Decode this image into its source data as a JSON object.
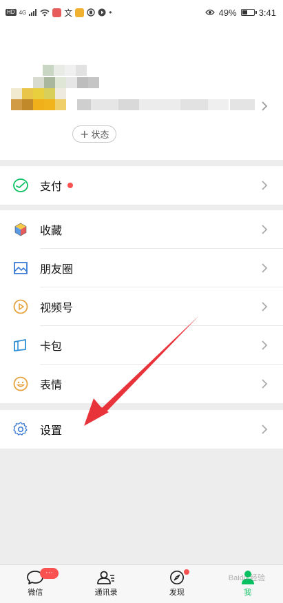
{
  "status_bar": {
    "hd": "HD",
    "network": "4G",
    "battery_percent": "49%",
    "battery_level": 0.49,
    "time": "3:41",
    "wen_icon_text": "文"
  },
  "profile": {
    "status_button_label": "状态",
    "status_button_plus": "+"
  },
  "groups": [
    {
      "rows": [
        {
          "label": "支付",
          "icon": "pay-icon",
          "badge_dot": true
        }
      ]
    },
    {
      "rows": [
        {
          "label": "收藏",
          "icon": "favorites-cube-icon"
        },
        {
          "label": "朋友圈",
          "icon": "moments-image-icon"
        },
        {
          "label": "视频号",
          "icon": "channels-play-icon"
        },
        {
          "label": "卡包",
          "icon": "card-wallet-icon"
        },
        {
          "label": "表情",
          "icon": "sticker-smile-icon"
        }
      ]
    },
    {
      "rows": [
        {
          "label": "设置",
          "icon": "settings-gear-icon"
        }
      ]
    }
  ],
  "bottom_nav": {
    "tabs": [
      {
        "label": "微信",
        "icon": "chat-icon",
        "badge": "···"
      },
      {
        "label": "通讯录",
        "icon": "contacts-icon"
      },
      {
        "label": "发现",
        "icon": "discover-compass-icon",
        "dot": true
      },
      {
        "label": "我",
        "icon": "me-person-icon",
        "active": true
      }
    ],
    "watermark": "Baidu 经验"
  },
  "colors": {
    "accent_green": "#07c160",
    "badge_red": "#fa5151",
    "annotation_arrow": "#e8333a"
  }
}
